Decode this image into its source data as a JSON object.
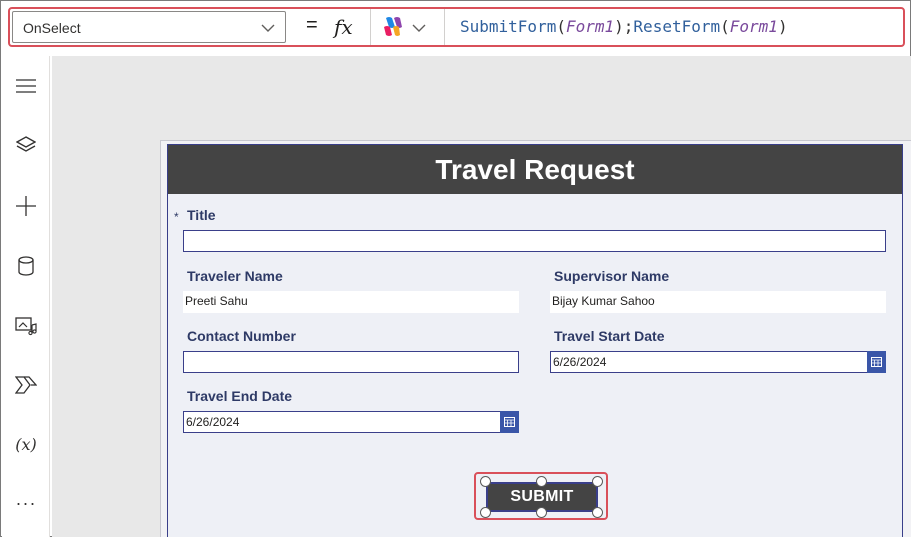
{
  "formula_bar": {
    "property": "OnSelect",
    "equals": "=",
    "fx": "fx",
    "formula_fn1": "SubmitForm",
    "formula_arg1": "Form1",
    "formula_sep": ";",
    "formula_fn2": "ResetForm",
    "formula_arg2": "Form1"
  },
  "rail": {
    "more_label": "···",
    "variables_label": "(x)"
  },
  "form": {
    "title": "Travel Request",
    "required_marker": "*",
    "title_label": "Title",
    "title_value": "",
    "traveler_label": "Traveler Name",
    "traveler_value": "Preeti Sahu",
    "supervisor_label": "Supervisor Name",
    "supervisor_value": "Bijay Kumar Sahoo",
    "contact_label": "Contact Number",
    "contact_value": "",
    "start_label": "Travel Start Date",
    "start_value": "6/26/2024",
    "end_label": "Travel End Date",
    "end_value": "6/26/2024",
    "submit_label": "SUBMIT"
  },
  "colors": {
    "accent": "#3a56a8",
    "highlight": "#d9505a",
    "header": "#444444"
  }
}
